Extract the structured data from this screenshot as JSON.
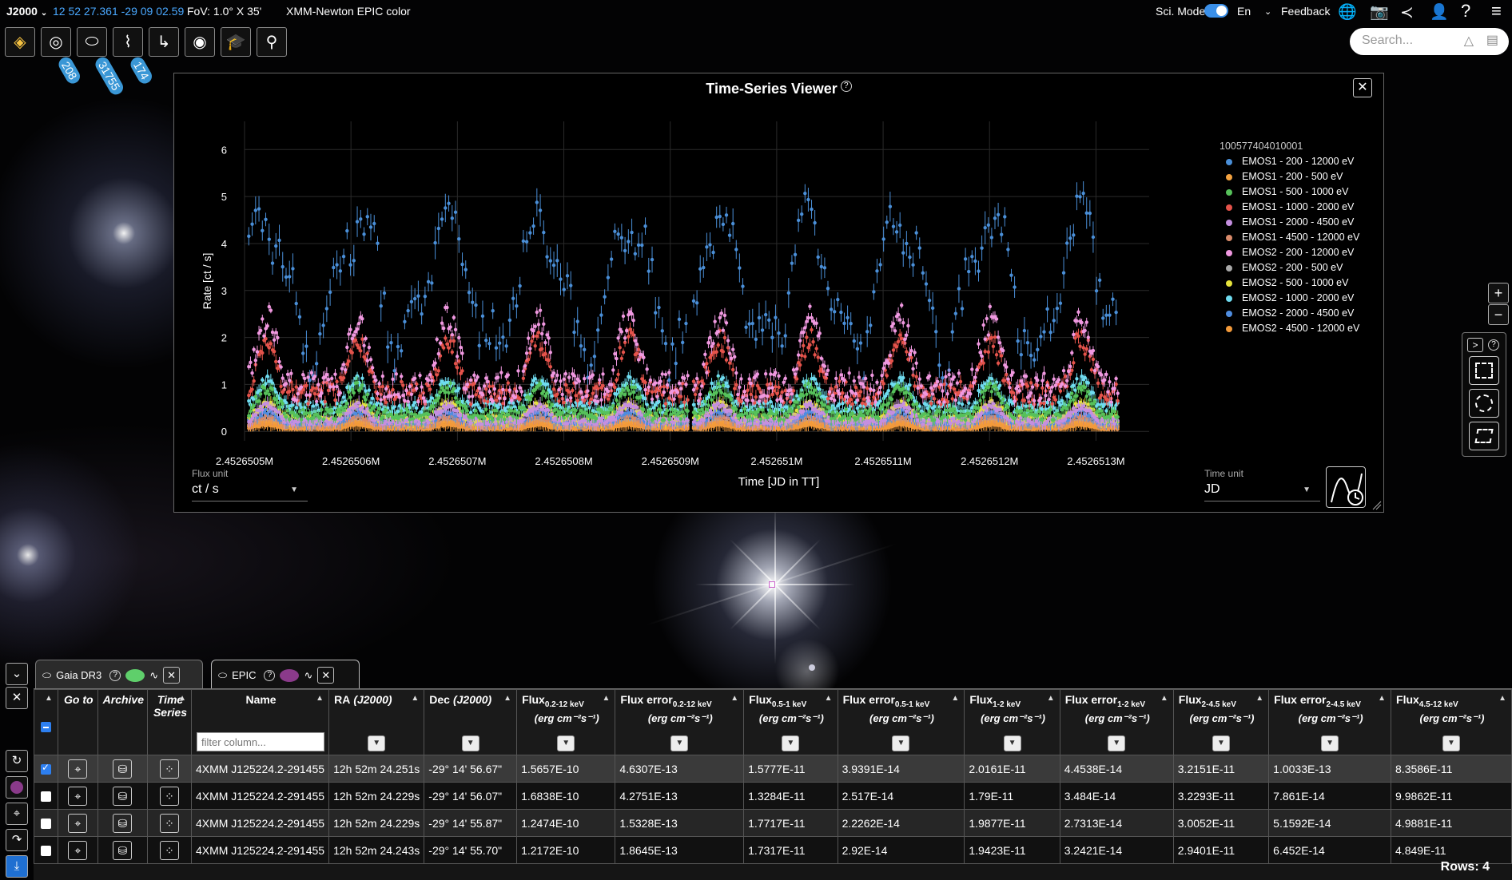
{
  "header": {
    "frame": "J2000",
    "coords": "12 52 27.361 -29 09 02.59",
    "fov": "FoV: 1.0° X 35'",
    "survey": "XMM-Newton EPIC color",
    "sci_mode_label": "Sci. Mode",
    "sci_mode_on": true,
    "lang": "En",
    "feedback": "Feedback",
    "search_placeholder": "Search..."
  },
  "toolbar": {
    "buttons": [
      "layers-icon",
      "galaxy-icon",
      "catalogue-icon",
      "spectrum-icon",
      "target-list-icon",
      "observation-icon",
      "tutorial-icon",
      "telescope-icon"
    ],
    "badges": [
      "208",
      "31755",
      "174"
    ]
  },
  "tsv": {
    "title": "Time-Series Viewer",
    "flux_unit_label": "Flux unit",
    "flux_unit": "ct / s",
    "time_unit_label": "Time unit",
    "time_unit": "JD"
  },
  "chart_data": {
    "type": "scatter",
    "title": "Time-Series Viewer",
    "xlabel": "Time [JD in TT]",
    "ylabel": "Rate [ct / s]",
    "xlim": [
      2452650.5,
      2452651.35
    ],
    "ylim": [
      -0.2,
      6.6
    ],
    "x_ticks": [
      "2.4526505M",
      "2.4526506M",
      "2.4526507M",
      "2.4526508M",
      "2.4526509M",
      "2.452651M",
      "2.4526511M",
      "2.4526512M",
      "2.4526513M"
    ],
    "y_ticks": [
      "0",
      "1",
      "2",
      "3",
      "4",
      "5",
      "6"
    ],
    "legend_title": "100577404010001",
    "legend_position": "right",
    "series": [
      {
        "name": "EMOS1 - 200 - 12000 eV",
        "color": "#4a8fd8",
        "level": 3.1,
        "amp": 1.5
      },
      {
        "name": "EMOS1 - 200 - 500 eV",
        "color": "#f4a340",
        "level": 0.12,
        "amp": 0.06
      },
      {
        "name": "EMOS1 - 500 - 1000 eV",
        "color": "#56c15a",
        "level": 0.5,
        "amp": 0.35
      },
      {
        "name": "EMOS1 - 1000 - 2000 eV",
        "color": "#e5534b",
        "level": 1.1,
        "amp": 0.7
      },
      {
        "name": "EMOS1 - 2000 - 4500 eV",
        "color": "#c58fe0",
        "level": 0.3,
        "amp": 0.2
      },
      {
        "name": "EMOS1 - 4500 - 12000 eV",
        "color": "#d98b6b",
        "level": 0.2,
        "amp": 0.1
      },
      {
        "name": "EMOS2 - 200 - 12000 eV",
        "color": "#f098e0",
        "level": 1.3,
        "amp": 0.9
      },
      {
        "name": "EMOS2 - 200 - 500 eV",
        "color": "#a8a8a8",
        "level": 0.15,
        "amp": 0.07
      },
      {
        "name": "EMOS2 - 500 - 1000 eV",
        "color": "#e6e33c",
        "level": 0.35,
        "amp": 0.2
      },
      {
        "name": "EMOS2 - 1000 - 2000 eV",
        "color": "#6fdcf0",
        "level": 0.65,
        "amp": 0.35
      },
      {
        "name": "EMOS2 - 2000 - 4500 eV",
        "color": "#4f8de0",
        "level": 0.25,
        "amp": 0.15
      },
      {
        "name": "EMOS2 - 4500 - 12000 eV",
        "color": "#f39a3a",
        "level": 0.08,
        "amp": 0.05
      }
    ]
  },
  "tabs": [
    {
      "label": "Gaia DR3",
      "color": "#5fcf6b"
    },
    {
      "label": "EPIC",
      "color": "#8a3a8a"
    }
  ],
  "table": {
    "filter_placeholder": "filter column...",
    "columns": [
      {
        "title": "",
        "unit": ""
      },
      {
        "title": "Go to",
        "unit": ""
      },
      {
        "title": "Archive",
        "unit": ""
      },
      {
        "title": "Time Series",
        "unit": ""
      },
      {
        "title": "Name",
        "unit": ""
      },
      {
        "title": "RA",
        "unit": "(J2000)"
      },
      {
        "title": "Dec",
        "unit": "(J2000)"
      },
      {
        "title": "Flux",
        "sub": "0.2-12 keV",
        "unit": "(erg cm⁻²s⁻¹)"
      },
      {
        "title": "Flux error",
        "sub": "0.2-12 keV",
        "unit": "(erg cm⁻²s⁻¹)"
      },
      {
        "title": "Flux",
        "sub": "0.5-1 keV",
        "unit": "(erg cm⁻²s⁻¹)"
      },
      {
        "title": "Flux error",
        "sub": "0.5-1 keV",
        "unit": "(erg cm⁻²s⁻¹)"
      },
      {
        "title": "Flux",
        "sub": "1-2 keV",
        "unit": "(erg cm⁻²s⁻¹)"
      },
      {
        "title": "Flux error",
        "sub": "1-2 keV",
        "unit": "(erg cm⁻²s⁻¹)"
      },
      {
        "title": "Flux",
        "sub": "2-4.5 keV",
        "unit": "(erg cm⁻²s⁻¹)"
      },
      {
        "title": "Flux error",
        "sub": "2-4.5 keV",
        "unit": "(erg cm⁻²s⁻¹)"
      },
      {
        "title": "Flux",
        "sub": "4.5-12 keV",
        "unit": "(erg cm⁻²s⁻¹)"
      }
    ],
    "rows": [
      {
        "checked": true,
        "name": "4XMM J125224.2-291455",
        "ra": "12h 52m 24.251s",
        "dec": "-29° 14' 56.67\"",
        "v": [
          "1.5657E-10",
          "4.6307E-13",
          "1.5777E-11",
          "3.9391E-14",
          "2.0161E-11",
          "4.4538E-14",
          "3.2151E-11",
          "1.0033E-13",
          "8.3586E-11"
        ]
      },
      {
        "checked": false,
        "name": "4XMM J125224.2-291455",
        "ra": "12h 52m 24.229s",
        "dec": "-29° 14' 56.07\"",
        "v": [
          "1.6838E-10",
          "4.2751E-13",
          "1.3284E-11",
          "2.517E-14",
          "1.79E-11",
          "3.484E-14",
          "3.2293E-11",
          "7.861E-14",
          "9.9862E-11"
        ]
      },
      {
        "checked": false,
        "name": "4XMM J125224.2-291455",
        "ra": "12h 52m 24.229s",
        "dec": "-29° 14' 55.87\"",
        "v": [
          "1.2474E-10",
          "1.5328E-13",
          "1.7717E-11",
          "2.2262E-14",
          "1.9877E-11",
          "2.7313E-14",
          "3.0052E-11",
          "5.1592E-14",
          "4.9881E-11"
        ]
      },
      {
        "checked": false,
        "name": "4XMM J125224.2-291455",
        "ra": "12h 52m 24.243s",
        "dec": "-29° 14' 55.70\"",
        "v": [
          "1.2172E-10",
          "1.8645E-13",
          "1.7317E-11",
          "2.92E-14",
          "1.9423E-11",
          "3.2421E-14",
          "2.9401E-11",
          "6.452E-14",
          "4.849E-11"
        ]
      }
    ],
    "rows_label": "Rows: 4"
  }
}
